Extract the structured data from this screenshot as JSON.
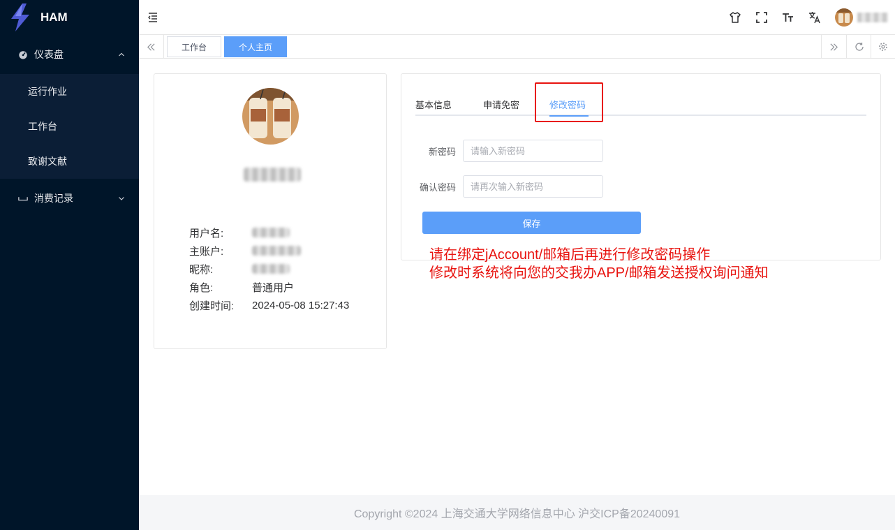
{
  "app": {
    "name": "HAM"
  },
  "sidebar": {
    "groups": [
      {
        "label": "仪表盘",
        "icon": "dashboard-icon",
        "expanded": true,
        "items": [
          {
            "label": "运行作业"
          },
          {
            "label": "工作台"
          },
          {
            "label": "致谢文献"
          }
        ]
      },
      {
        "label": "消费记录",
        "icon": "receipt-icon",
        "expanded": false
      }
    ]
  },
  "header": {
    "icons": [
      "theme-icon",
      "fullscreen-icon",
      "font-size-icon",
      "language-icon"
    ]
  },
  "tags": [
    {
      "label": "工作台",
      "active": false
    },
    {
      "label": "个人主页",
      "active": true
    }
  ],
  "profile": {
    "info": [
      {
        "key": "用户名:",
        "value": ""
      },
      {
        "key": "主账户:",
        "value": ""
      },
      {
        "key": "昵称:",
        "value": ""
      },
      {
        "key": "角色:",
        "value": "普通用户"
      },
      {
        "key": "创建时间:",
        "value": "2024-05-08 15:27:43"
      }
    ]
  },
  "settings": {
    "tabs": [
      {
        "label": "基本信息",
        "active": false
      },
      {
        "label": "申请免密",
        "active": false
      },
      {
        "label": "修改密码",
        "active": true
      }
    ],
    "form": {
      "new_password": {
        "label": "新密码",
        "placeholder": "请输入新密码",
        "value": ""
      },
      "confirm_password": {
        "label": "确认密码",
        "placeholder": "请再次输入新密码",
        "value": ""
      },
      "save_label": "保存"
    }
  },
  "annotation": {
    "line1": "请在绑定jAccount/邮箱后再进行修改密码操作",
    "line2": "修改时系统将向您的交我办APP/邮箱发送授权询问通知",
    "color": "#e8130f"
  },
  "footer": {
    "text": "Copyright ©2024 上海交通大学网络信息中心 沪交ICP备20240091"
  },
  "colors": {
    "sidebar_bg": "#001529",
    "accent": "#5b9ef9"
  }
}
